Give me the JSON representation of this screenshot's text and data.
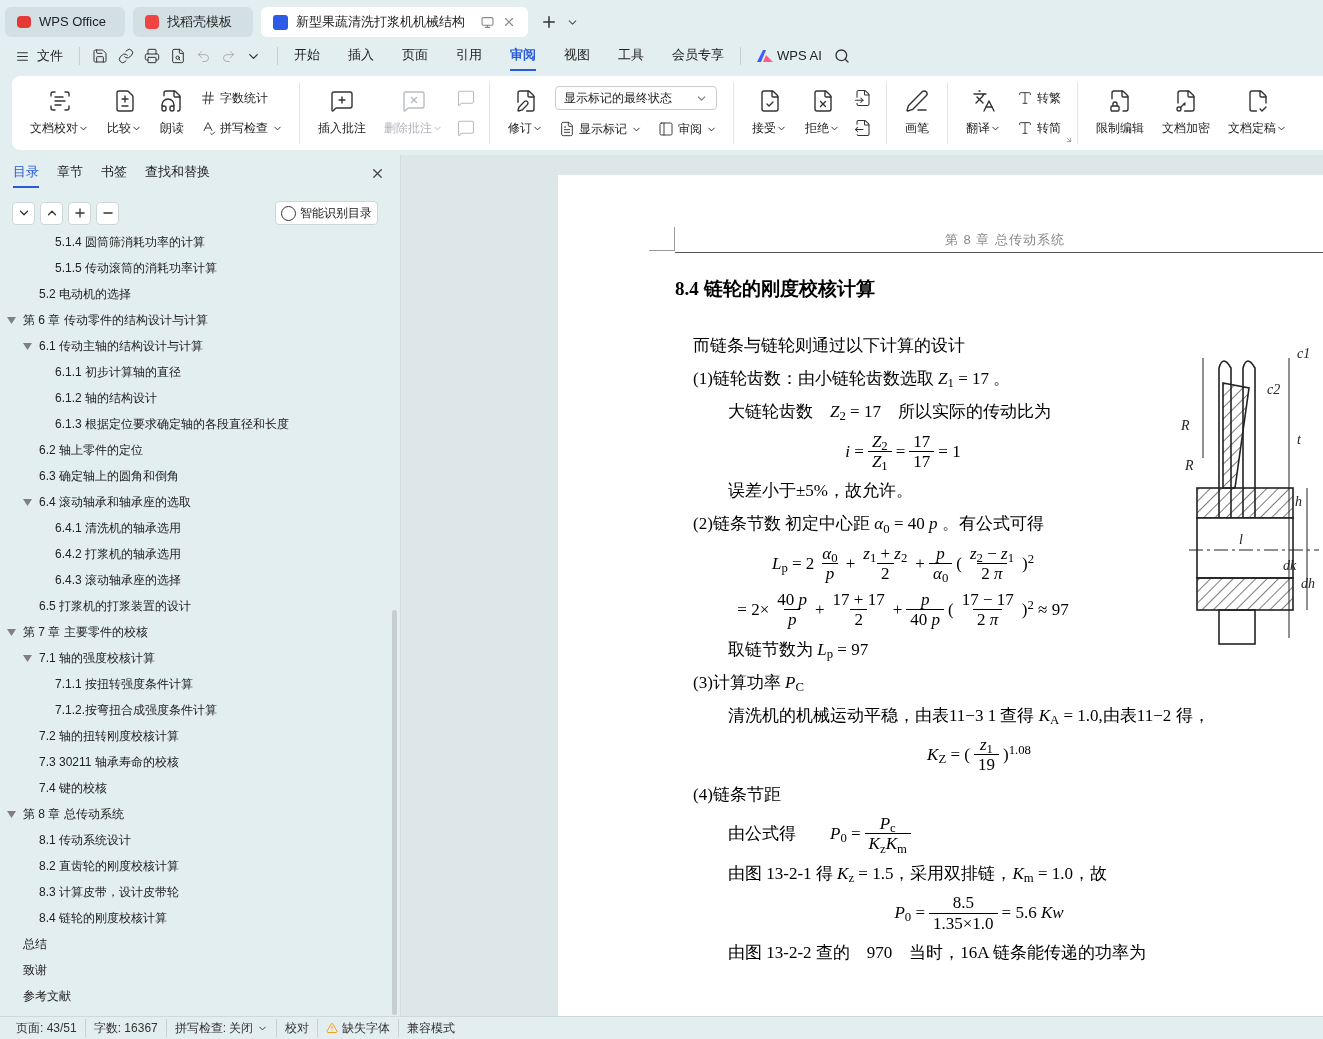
{
  "tabs": [
    {
      "label": "WPS Office",
      "kind": "wps",
      "selected": false
    },
    {
      "label": "找稻壳模板",
      "kind": "docer",
      "selected": false
    },
    {
      "label": "新型果蔬清洗打浆机机械结构",
      "kind": "doc",
      "selected": true
    }
  ],
  "menu": {
    "file": "文件",
    "tabs": [
      {
        "label": "开始",
        "selected": false
      },
      {
        "label": "插入",
        "selected": false
      },
      {
        "label": "页面",
        "selected": false
      },
      {
        "label": "引用",
        "selected": false
      },
      {
        "label": "审阅",
        "selected": true
      },
      {
        "label": "视图",
        "selected": false
      },
      {
        "label": "工具",
        "selected": false
      },
      {
        "label": "会员专享",
        "selected": false
      }
    ],
    "ai": "WPS AI"
  },
  "ribbon": [
    {
      "launcher": false,
      "items": [
        {
          "kind": "big",
          "label": "文档校对",
          "caret": true,
          "disabled": false
        },
        {
          "kind": "big",
          "label": "比较",
          "caret": true,
          "disabled": false
        },
        {
          "kind": "big",
          "label": "朗读",
          "caret": false,
          "disabled": false
        },
        {
          "kind": "stack",
          "items": [
            {
              "kind": "small",
              "label": "字数统计",
              "caret": false,
              "disabled": false
            },
            {
              "kind": "small",
              "label": "拼写检查",
              "caret": true,
              "disabled": false
            }
          ]
        }
      ]
    },
    {
      "launcher": false,
      "items": [
        {
          "kind": "big",
          "label": "插入批注",
          "caret": false,
          "disabled": false
        },
        {
          "kind": "big",
          "label": "删除批注",
          "caret": true,
          "disabled": true
        },
        {
          "kind": "stack",
          "items": [
            {
              "kind": "icon",
              "disabled": true
            },
            {
              "kind": "icon",
              "disabled": true
            }
          ]
        }
      ]
    },
    {
      "launcher": false,
      "items": [
        {
          "kind": "big",
          "label": "修订",
          "caret": true,
          "disabled": false
        },
        {
          "kind": "stack",
          "items": [
            {
              "kind": "select",
              "value": "显示标记的最终状态"
            },
            {
              "kind": "row",
              "items": [
                {
                  "kind": "small",
                  "label": "显示标记",
                  "caret": true,
                  "disabled": false
                },
                {
                  "kind": "small",
                  "label": "审阅",
                  "caret": true,
                  "disabled": false
                }
              ]
            }
          ]
        }
      ]
    },
    {
      "launcher": false,
      "items": [
        {
          "kind": "big",
          "label": "接受",
          "caret": true,
          "disabled": false
        },
        {
          "kind": "big",
          "label": "拒绝",
          "caret": true,
          "disabled": false
        },
        {
          "kind": "stack",
          "items": [
            {
              "kind": "icon",
              "disabled": false
            },
            {
              "kind": "icon",
              "disabled": false
            }
          ]
        }
      ]
    },
    {
      "launcher": false,
      "items": [
        {
          "kind": "big",
          "label": "画笔",
          "caret": false,
          "disabled": false
        }
      ]
    },
    {
      "launcher": true,
      "items": [
        {
          "kind": "big",
          "label": "翻译",
          "caret": true,
          "disabled": false
        },
        {
          "kind": "stack",
          "items": [
            {
              "kind": "small",
              "label": "转繁",
              "caret": false,
              "disabled": false
            },
            {
              "kind": "small",
              "label": "转简",
              "caret": false,
              "disabled": false
            }
          ]
        }
      ]
    },
    {
      "launcher": false,
      "items": [
        {
          "kind": "big",
          "label": "限制编辑",
          "caret": false,
          "disabled": false
        },
        {
          "kind": "big",
          "label": "文档加密",
          "caret": false,
          "disabled": false
        },
        {
          "kind": "big",
          "label": "文档定稿",
          "caret": true,
          "disabled": false
        }
      ]
    }
  ],
  "sidebar": {
    "tabs": [
      {
        "label": "目录",
        "selected": true
      },
      {
        "label": "章节",
        "selected": false
      },
      {
        "label": "书签",
        "selected": false
      },
      {
        "label": "查找和替换",
        "selected": false
      }
    ],
    "smart_button": "智能识别目录",
    "toc": [
      {
        "children": [
          {
            "children": [
              {
                "text": "5.1.4 圆筒筛消耗功率的计算"
              },
              {
                "text": "5.1.5 传动滚筒的消耗功率计算"
              }
            ]
          },
          {
            "text": "5.2 电动机的选择"
          }
        ]
      },
      {
        "text": "第 6 章  传动零件的结构设计与计算",
        "expanded": true,
        "children": [
          {
            "text": "6.1 传动主轴的结构设计与计算",
            "expanded": true,
            "children": [
              {
                "text": "6.1.1 初步计算轴的直径"
              },
              {
                "text": "6.1.2 轴的结构设计"
              },
              {
                "text": "6.1.3  根据定位要求确定轴的各段直径和长度"
              }
            ]
          },
          {
            "text": "6.2 轴上零件的定位"
          },
          {
            "text": "6.3 确定轴上的圆角和倒角"
          },
          {
            "text": "6.4 滚动轴承和轴承座的选取",
            "expanded": true,
            "children": [
              {
                "text": "6.4.1 清洗机的轴承选用"
              },
              {
                "text": "6.4.2 打浆机的轴承选用"
              },
              {
                "text": "6.4.3 滚动轴承座的选择"
              }
            ]
          },
          {
            "text": "6.5 打浆机的打浆装置的设计"
          }
        ]
      },
      {
        "text": "第 7 章  主要零件的校核",
        "expanded": true,
        "children": [
          {
            "text": "7.1 轴的强度校核计算",
            "expanded": true,
            "children": [
              {
                "text": "7.1.1 按扭转强度条件计算"
              },
              {
                "text": "7.1.2.按弯扭合成强度条件计算"
              }
            ]
          },
          {
            "text": "7.2 轴的扭转刚度校核计算"
          },
          {
            "text": "7.3 30211 轴承寿命的校核"
          },
          {
            "text": "7.4 键的校核"
          }
        ]
      },
      {
        "text": "第 8 章  总传动系统",
        "expanded": true,
        "children": [
          {
            "text": "8.1 传动系统设计"
          },
          {
            "text": "8.2 直齿轮的刚度校核计算"
          },
          {
            "text": "8.3 计算皮带，设计皮带轮"
          },
          {
            "text": "8.4 链轮的刚度校核计算"
          }
        ]
      },
      {
        "text": "总结"
      },
      {
        "text": "致谢"
      },
      {
        "text": "参考文献"
      }
    ]
  },
  "document": {
    "header": "第 8 章  总传动系统",
    "heading": "8.4 链轮的刚度校核计算",
    "figure_labels": [
      "c1",
      "c2",
      "R",
      "t",
      "R",
      "h",
      "l",
      "dk",
      "dh"
    ],
    "blocks": [
      {
        "kind": "lead",
        "parts": [
          {
            "kind": "t",
            "s": "而链条与链轮则通过以下计算的设计"
          }
        ]
      },
      {
        "kind": "lead",
        "parts": [
          {
            "kind": "t",
            "s": "(1)链轮齿数：由小链轮齿数选取 *Z*$_{1}$ = 17 。"
          }
        ]
      },
      {
        "kind": "sub",
        "parts": [
          {
            "kind": "t",
            "s": "大链轮齿数　*Z*$_{2}$ = 17　所以实际的传动比为"
          }
        ]
      },
      {
        "kind": "eq",
        "parts": [
          {
            "kind": "t",
            "s": "*i* ="
          },
          {
            "kind": "frac",
            "num": "*Z*$_{2}$",
            "den": "*Z*$_{1}$"
          },
          {
            "kind": "t",
            "s": "="
          },
          {
            "kind": "frac",
            "num": "17",
            "den": "17"
          },
          {
            "kind": "t",
            "s": "= 1"
          }
        ]
      },
      {
        "kind": "sub",
        "parts": [
          {
            "kind": "t",
            "s": "误差小于±5%，故允许。"
          }
        ]
      },
      {
        "kind": "lead",
        "parts": [
          {
            "kind": "t",
            "s": "(2)链条节数  初定中心距 *α*$_{0}$ = 40 *p* 。有公式可得"
          }
        ]
      },
      {
        "kind": "eq",
        "parts": [
          {
            "kind": "t",
            "s": "*L*$_{p}$ = 2"
          },
          {
            "kind": "frac",
            "num": "*α*$_{0}$",
            "den": "*p*"
          },
          {
            "kind": "t",
            "s": "+"
          },
          {
            "kind": "frac",
            "num": "*z*$_{1}$ + *z*$_{2}$",
            "den": "2"
          },
          {
            "kind": "t",
            "s": "+"
          },
          {
            "kind": "frac",
            "num": "*p*",
            "den": "*α*$_{0}$"
          },
          {
            "kind": "t",
            "s": "("
          },
          {
            "kind": "frac",
            "num": "*z*$_{2}$ − *z*$_{1}$",
            "den": "2 *π*"
          },
          {
            "kind": "t",
            "s": ")$^{2}$"
          }
        ]
      },
      {
        "kind": "eq",
        "parts": [
          {
            "kind": "t",
            "s": "= 2×"
          },
          {
            "kind": "frac",
            "num": "40 *p*",
            "den": "*p*"
          },
          {
            "kind": "t",
            "s": "+"
          },
          {
            "kind": "frac",
            "num": "17 + 17",
            "den": "2"
          },
          {
            "kind": "t",
            "s": "+"
          },
          {
            "kind": "frac",
            "num": "*p*",
            "den": "40 *p*"
          },
          {
            "kind": "t",
            "s": "("
          },
          {
            "kind": "frac",
            "num": "17 − 17",
            "den": "2 *π*"
          },
          {
            "kind": "t",
            "s": ")$^{2}$ ≈ 97"
          }
        ]
      },
      {
        "kind": "sub",
        "parts": [
          {
            "kind": "t",
            "s": "取链节数为 *L*$_{p}$ = 97"
          }
        ]
      },
      {
        "kind": "lead",
        "parts": [
          {
            "kind": "t",
            "s": "(3)计算功率 *P*$_{C}$"
          }
        ]
      },
      {
        "kind": "sub",
        "parts": [
          {
            "kind": "t",
            "s": "清洗机的机械运动平稳，由表11−3 1 查得 *K*$_{A}$ = 1.0,由表11−2 得，"
          }
        ]
      },
      {
        "kind": "eq",
        "parts": [
          {
            "kind": "t",
            "s": "*K*$_{Z}$ = ("
          },
          {
            "kind": "frac",
            "num": "*z*$_{1}$",
            "den": "19"
          },
          {
            "kind": "t",
            "s": ")$^{1.08}$"
          }
        ]
      },
      {
        "kind": "lead",
        "parts": [
          {
            "kind": "t",
            "s": "(4)链条节距"
          }
        ]
      },
      {
        "kind": "sub",
        "parts": [
          {
            "kind": "t",
            "s": "由公式得　　*P*$_{0}$ ="
          },
          {
            "kind": "frac",
            "num": "*P*$_{c}$",
            "den": "*K*$_{z}$*K*$_{m}$"
          }
        ]
      },
      {
        "kind": "sub",
        "parts": [
          {
            "kind": "t",
            "s": "由图 13-2-1 得 *K*$_{z}$ = 1.5，采用双排链，*K*$_{m}$ = 1.0，故"
          }
        ]
      },
      {
        "kind": "eq",
        "parts": [
          {
            "kind": "t",
            "s": "*P*$_{0}$ ="
          },
          {
            "kind": "frac",
            "num": "8.5",
            "den": "1.35×1.0"
          },
          {
            "kind": "t",
            "s": "= 5.6 *Kw*"
          }
        ]
      },
      {
        "kind": "sub",
        "parts": [
          {
            "kind": "t",
            "s": "由图 13-2-2 查的　970　当时，16A 链条能传递的功率为"
          }
        ]
      }
    ]
  },
  "status": [
    {
      "kind": "text",
      "label": "页面: 43/51"
    },
    {
      "kind": "text",
      "label": "字数: 16367"
    },
    {
      "kind": "dropdown",
      "label": "拼写检查: 关闭"
    },
    {
      "kind": "text",
      "label": "校对"
    },
    {
      "kind": "warning",
      "label": "缺失字体"
    },
    {
      "kind": "text",
      "label": "兼容模式"
    }
  ]
}
